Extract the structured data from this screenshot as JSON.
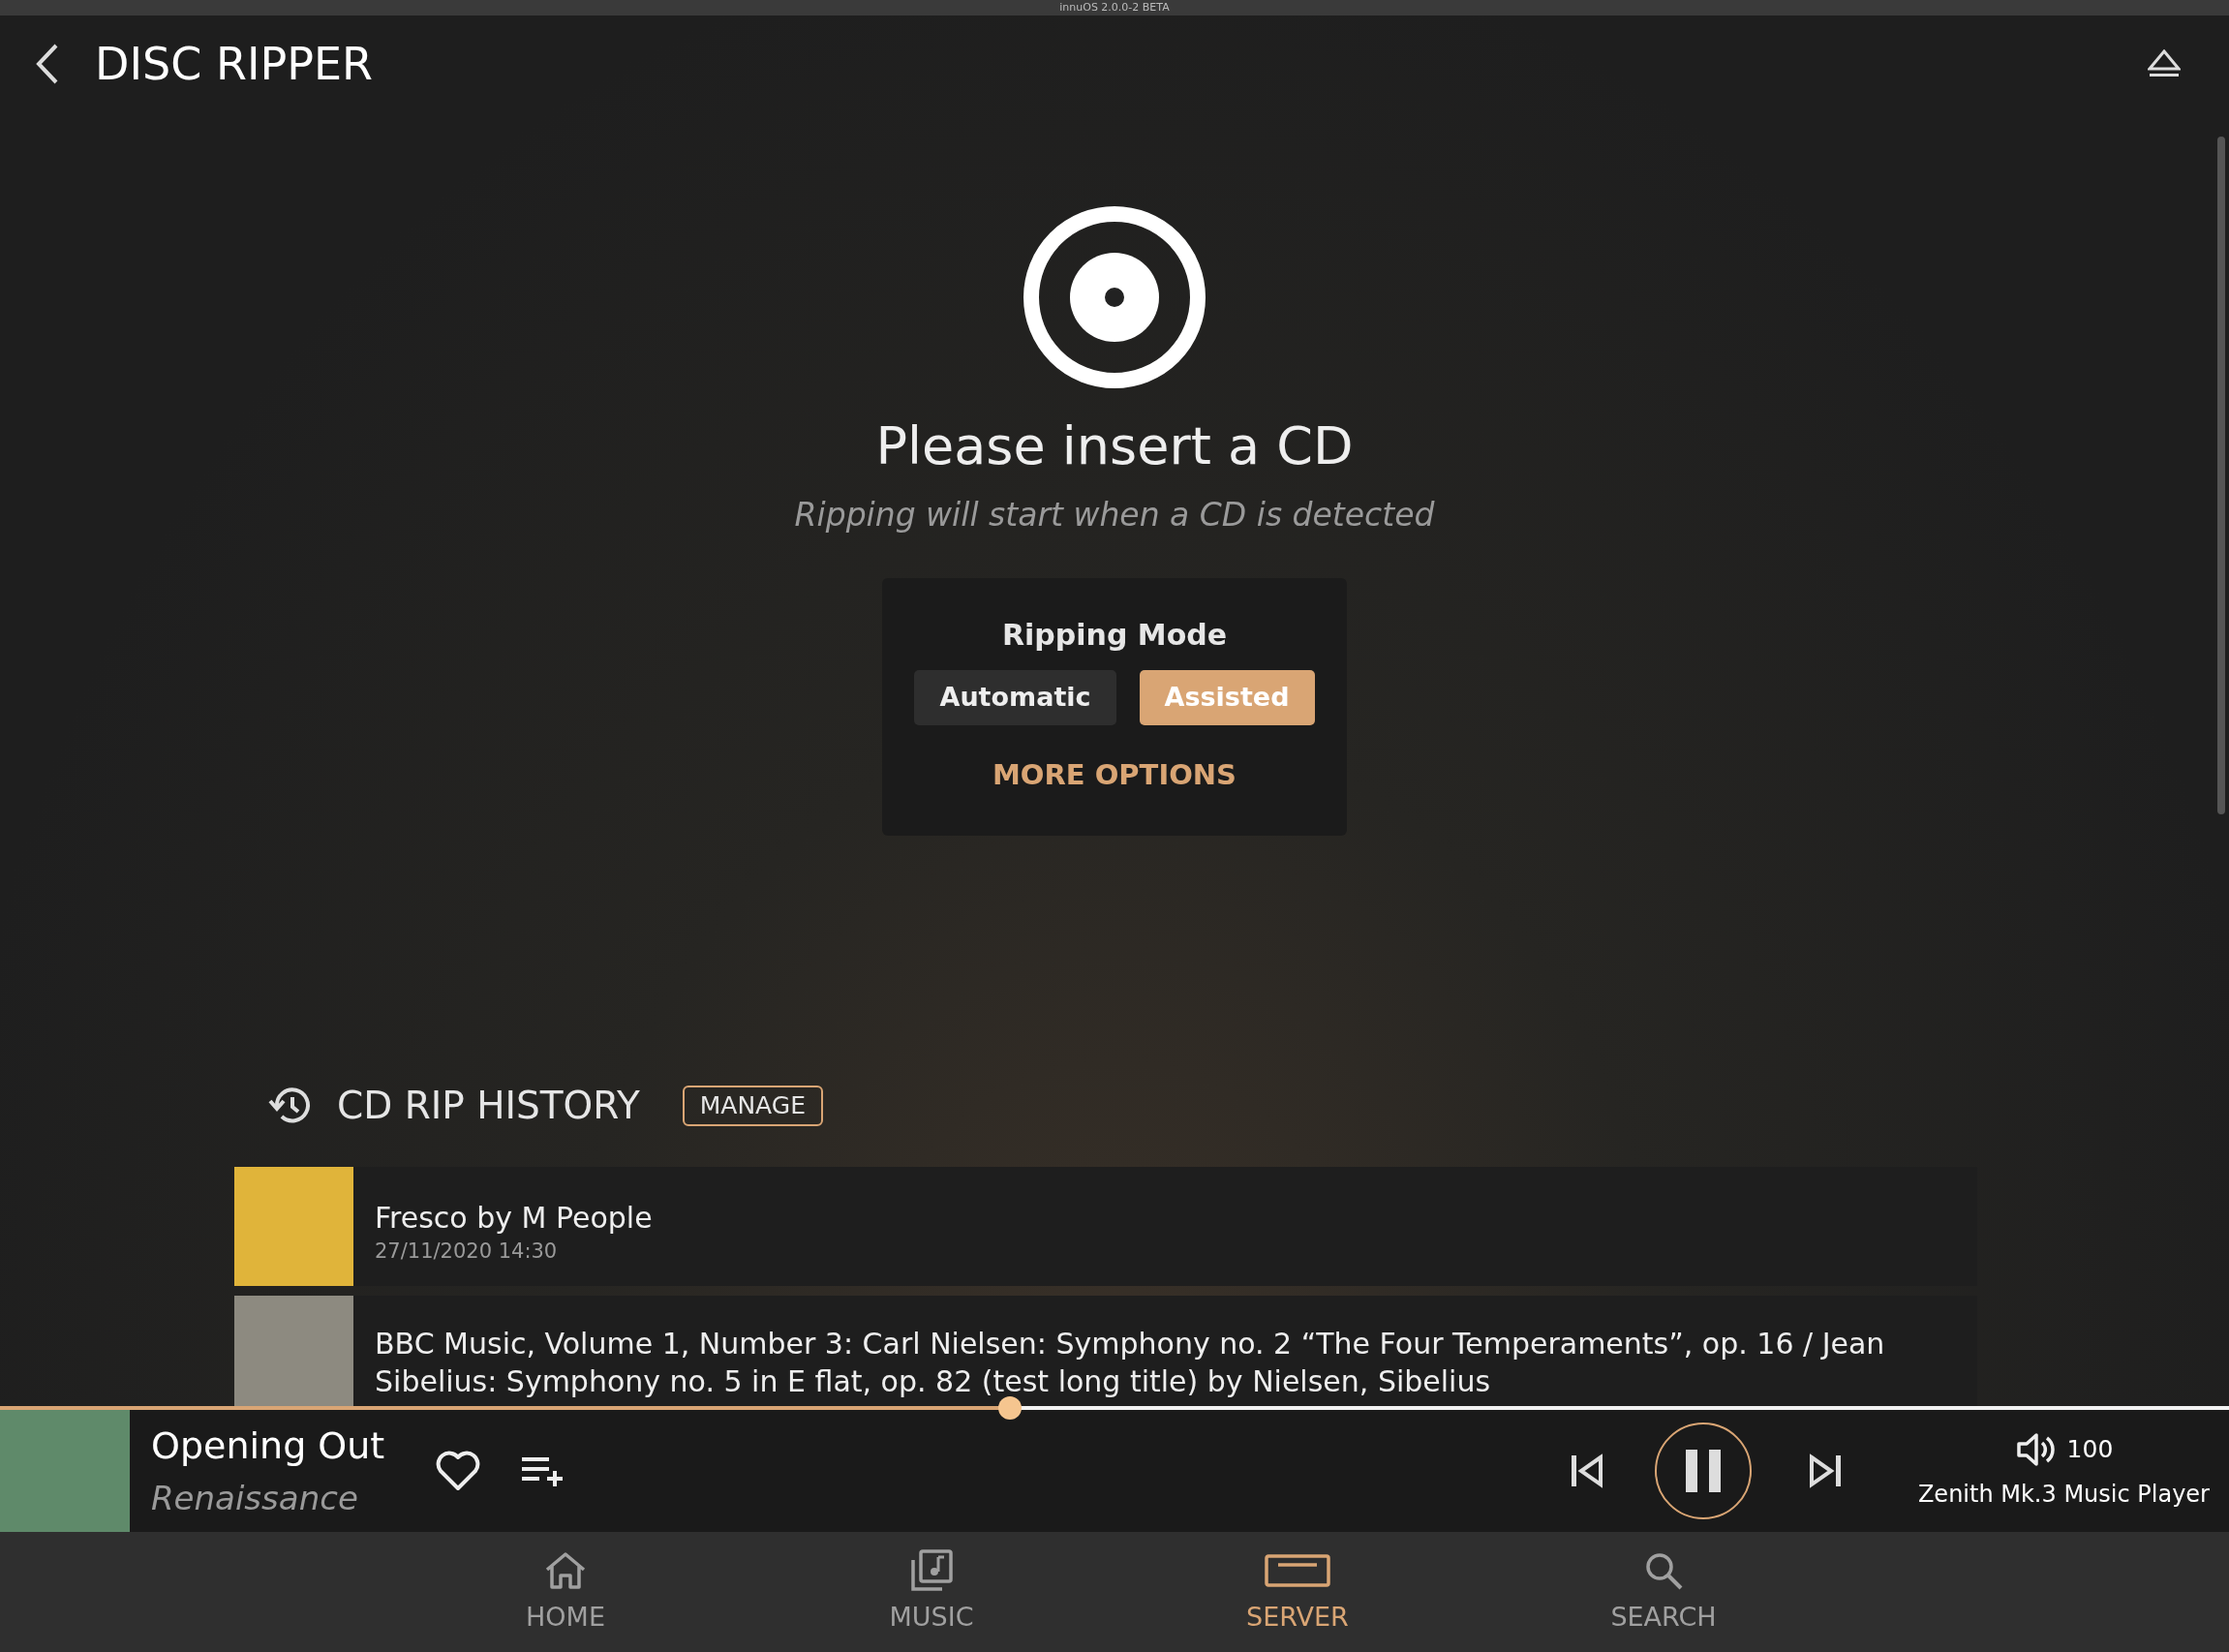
{
  "status_bar": {
    "text": "innuOS 2.0.0-2 BETA"
  },
  "header": {
    "title": "DISC RIPPER"
  },
  "prompt": {
    "title": "Please insert a CD",
    "subtitle": "Ripping will start when a CD is detected"
  },
  "ripping_mode": {
    "title": "Ripping Mode",
    "options": [
      {
        "label": "Automatic",
        "selected": false
      },
      {
        "label": "Assisted",
        "selected": true
      }
    ],
    "more_options": "MORE OPTIONS"
  },
  "history": {
    "title": "CD RIP HISTORY",
    "manage": "MANAGE",
    "items": [
      {
        "title": "Fresco by M People",
        "date": "27/11/2020 14:30"
      },
      {
        "title": "BBC Music, Volume 1, Number 3: Carl Nielsen: Symphony no. 2 “The Four Temperaments”, op. 16 / Jean Sibelius: Symphony no. 5 in E flat, op. 82 (test long title) by Nielsen, Sibelius"
      }
    ]
  },
  "player": {
    "track": "Opening Out",
    "album": "Renaissance",
    "level": 0.453,
    "playing": true,
    "volume": "100",
    "device": "Zenith Mk.3 Music Player"
  },
  "nav": [
    {
      "kind": "home",
      "label": "HOME",
      "selected": false
    },
    {
      "kind": "music",
      "label": "MUSIC",
      "selected": false
    },
    {
      "kind": "server",
      "label": "SERVER",
      "selected": true
    },
    {
      "kind": "search",
      "label": "SEARCH",
      "selected": false
    }
  ]
}
